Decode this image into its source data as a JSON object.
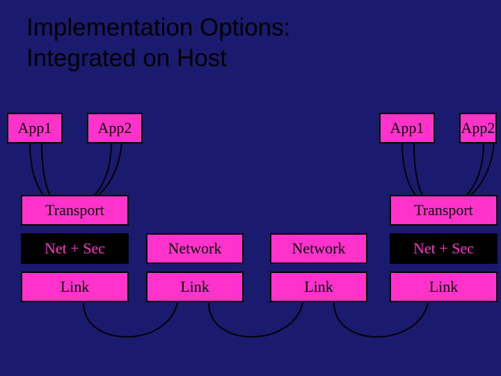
{
  "title": "Implementation Options:\nIntegrated on Host",
  "left": {
    "app1": "App1",
    "app2": "App2",
    "transport": "Transport",
    "net_sec": "Net + Sec",
    "link": "Link"
  },
  "mid1": {
    "network": "Network",
    "link": "Link"
  },
  "mid2": {
    "network": "Network",
    "link": "Link"
  },
  "right": {
    "app1": "App1",
    "app2": "App2",
    "transport": "Transport",
    "net_sec": "Net + Sec",
    "link": "Link"
  }
}
